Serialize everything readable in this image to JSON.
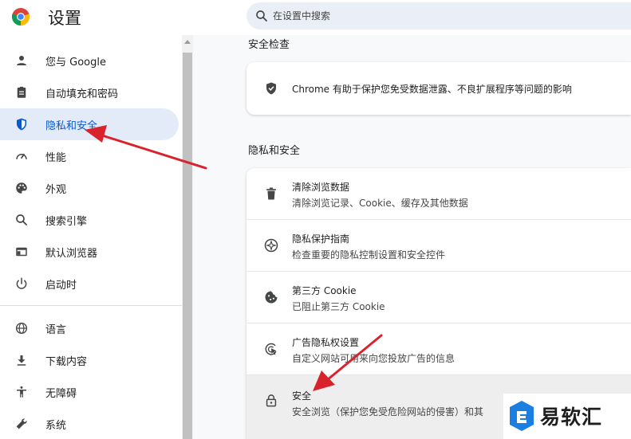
{
  "header": {
    "title": "设置",
    "search_placeholder": "在设置中搜索"
  },
  "sidebar": {
    "items": [
      {
        "label": "您与 Google",
        "icon": "person-icon"
      },
      {
        "label": "自动填充和密码",
        "icon": "clipboard-icon"
      },
      {
        "label": "隐私和安全",
        "icon": "shield-icon",
        "active": true
      },
      {
        "label": "性能",
        "icon": "speedometer-icon"
      },
      {
        "label": "外观",
        "icon": "palette-icon"
      },
      {
        "label": "搜索引擎",
        "icon": "search-icon"
      },
      {
        "label": "默认浏览器",
        "icon": "browser-window-icon"
      },
      {
        "label": "启动时",
        "icon": "power-icon"
      },
      {
        "label": "语言",
        "icon": "globe-icon"
      },
      {
        "label": "下载内容",
        "icon": "download-icon"
      },
      {
        "label": "无障碍",
        "icon": "accessibility-icon"
      },
      {
        "label": "系统",
        "icon": "wrench-icon"
      }
    ]
  },
  "safety_check": {
    "section_title": "安全检查",
    "text": "Chrome 有助于保护您免受数据泄露、不良扩展程序等问题的影响"
  },
  "privacy": {
    "section_title": "隐私和安全",
    "rows": [
      {
        "title": "清除浏览数据",
        "subtitle": "清除浏览记录、Cookie、缓存及其他数据",
        "icon": "trash-icon"
      },
      {
        "title": "隐私保护指南",
        "subtitle": "检查重要的隐私控制设置和安全控件",
        "icon": "privacy-guide-icon"
      },
      {
        "title": "第三方 Cookie",
        "subtitle": "已阻止第三方 Cookie",
        "icon": "cookie-icon"
      },
      {
        "title": "广告隐私权设置",
        "subtitle": "自定义网站可用来向您投放广告的信息",
        "icon": "ad-privacy-icon"
      },
      {
        "title": "安全",
        "subtitle": "安全浏览（保护您免受危险网站的侵害）和其",
        "icon": "lock-icon"
      }
    ]
  },
  "watermark": {
    "text": "易软汇"
  },
  "colors": {
    "accent": "#0b57d0",
    "active_bg": "#e3ebf8",
    "annotation": "#d9232c"
  }
}
